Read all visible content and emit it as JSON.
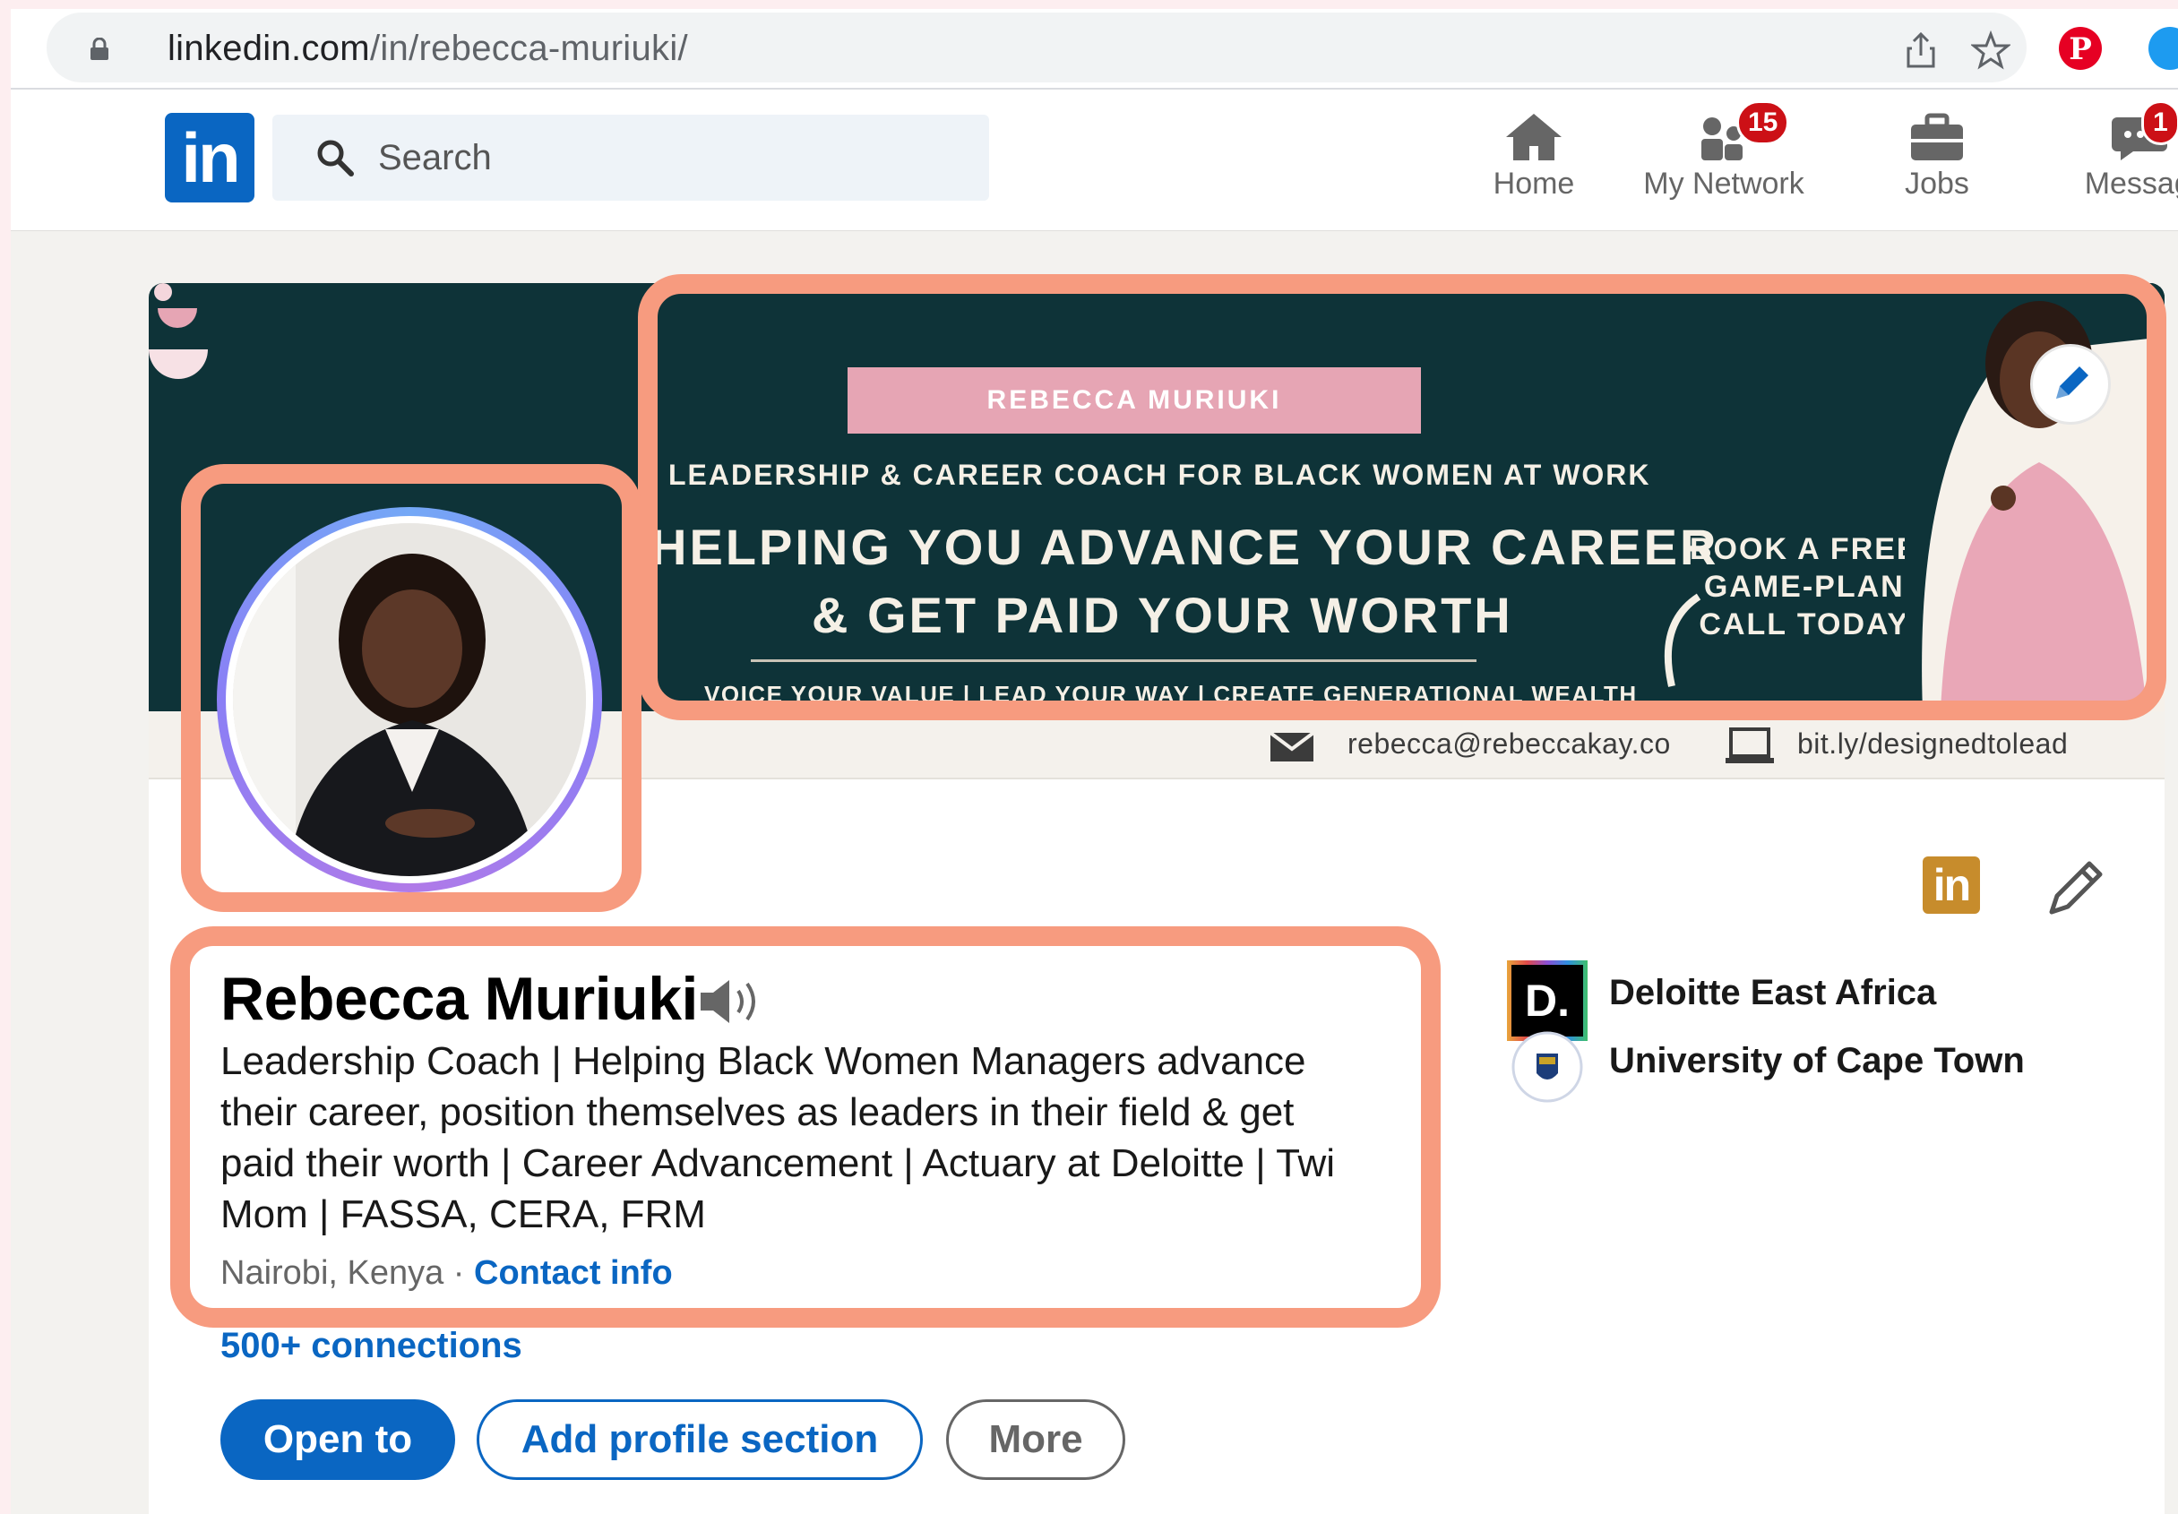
{
  "browser": {
    "url_host": "linkedin.com",
    "url_path": "/in/rebecca-muriuki/",
    "icons": [
      "lock-icon",
      "share-icon",
      "star-icon",
      "pinterest-icon",
      "extension-icon"
    ]
  },
  "nav": {
    "logo": "in",
    "search_placeholder": "Search",
    "items": [
      {
        "label": "Home",
        "icon": "home-icon"
      },
      {
        "label": "My Network",
        "icon": "network-icon",
        "badge": "15"
      },
      {
        "label": "Jobs",
        "icon": "briefcase-icon"
      },
      {
        "label": "Messagi",
        "icon": "messaging-icon",
        "badge": "1"
      }
    ]
  },
  "banner": {
    "name": "REBECCA MURIUKI",
    "subtitle": "LEADERSHIP & CAREER COACH FOR BLACK WOMEN AT WORK",
    "headline_line1": "HELPING YOU ADVANCE YOUR CAREER",
    "headline_line2": "& GET PAID YOUR WORTH",
    "tagline": "VOICE YOUR VALUE | LEAD YOUR WAY | CREATE GENERATIONAL WEALTH",
    "cta": "BOOK A FREE\nGAME-PLAN\nCALL TODAY",
    "email": "rebecca@rebeccakay.co",
    "link": "bit.ly/designedtolead",
    "colors": {
      "background": "#0e3338",
      "name_box": "#e6a5b4"
    }
  },
  "profile": {
    "name": "Rebecca Muriuki",
    "headline": "Leadership Coach | Helping Black Women Managers advance\ntheir career, position themselves as leaders in their field & get\npaid their worth | Career Advancement | Actuary at Deloitte | Twi\nMom | FASSA, CERA, FRM",
    "location": "Nairobi, Kenya",
    "separator": " · ",
    "contact_info": "Contact info",
    "connections": "500+ connections",
    "buttons": {
      "open_to": "Open to",
      "add_section": "Add profile section",
      "more": "More"
    },
    "orgs": [
      {
        "name": "Deloitte East Africa",
        "logo": "D."
      },
      {
        "name": "University of Cape Town",
        "logo": "uct-crest"
      }
    ],
    "accent": "#0a66c2",
    "highlight": "#f79b7f"
  }
}
